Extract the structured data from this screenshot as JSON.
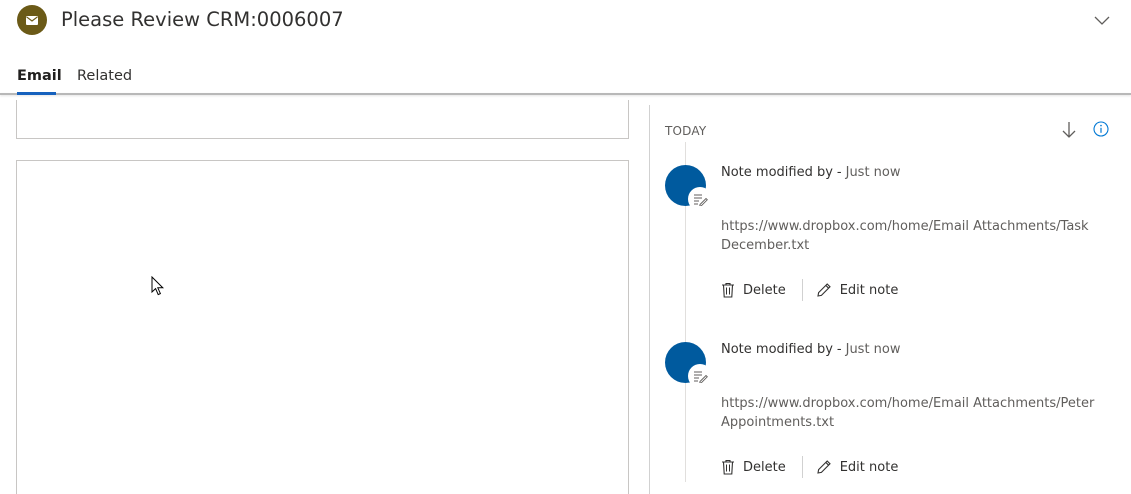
{
  "header": {
    "title": "Please Review CRM:0006007",
    "entity_icon": "envelope-icon",
    "accent_color": "#6b5a17"
  },
  "tabs": [
    {
      "label": "Email",
      "active": true
    },
    {
      "label": "Related",
      "active": false
    }
  ],
  "timeline": {
    "group_label": "TODAY",
    "notes": [
      {
        "meta": "Note modified by",
        "separator": "-",
        "time": "Just now",
        "text_line1": "https://www.dropbox.com/home/Email Attachments/Task",
        "text_line2": "December.txt",
        "delete_label": "Delete",
        "edit_label": "Edit note"
      },
      {
        "meta": "Note modified by",
        "separator": "-",
        "time": "Just now",
        "text_line1": "https://www.dropbox.com/home/Email Attachments/Peter",
        "text_line2": "Appointments.txt",
        "delete_label": "Delete",
        "edit_label": "Edit note"
      }
    ]
  },
  "colors": {
    "avatar": "#005a9e",
    "tab_underline": "#1661bd",
    "info_icon": "#0078d4"
  }
}
